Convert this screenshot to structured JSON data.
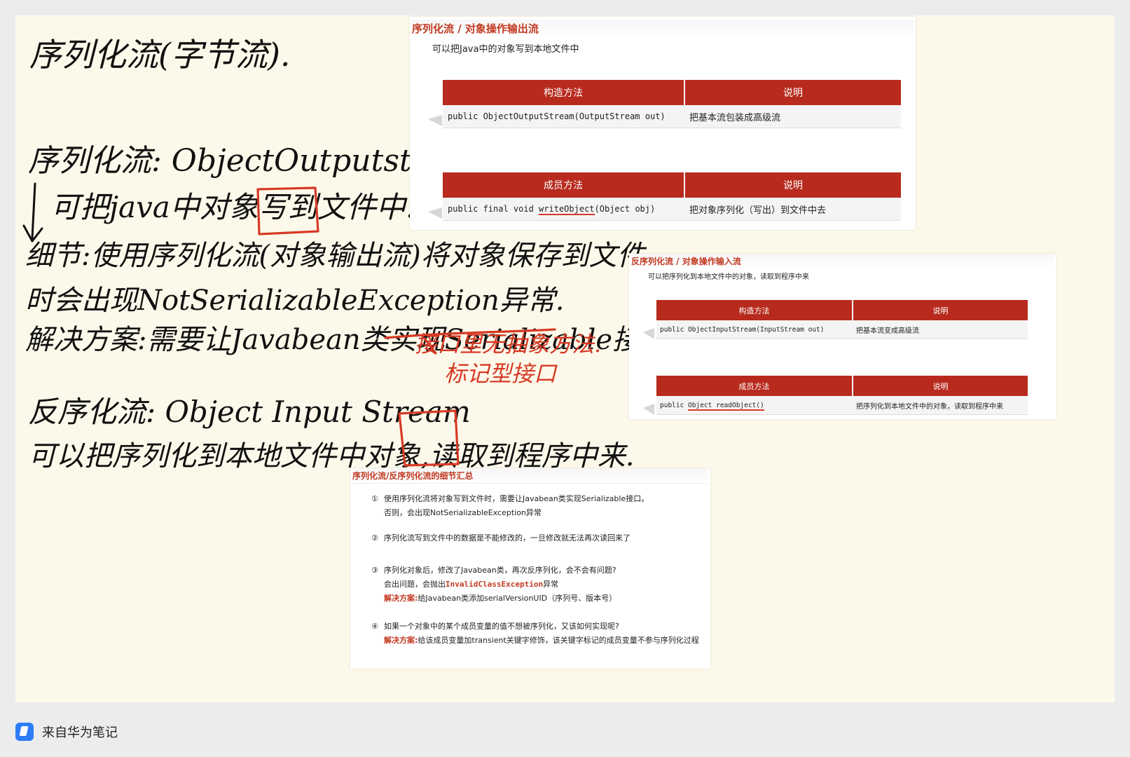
{
  "handwriting": {
    "title": "序列化流(字节流).",
    "line1": "序列化流: ObjectOutputstream.",
    "line2": "可把java中对象写到文件中.",
    "line3": "细节:使用序列化流(对象输出流)将对象保存到文件",
    "line4": "时会出现NotSerializableException异常.",
    "line5": "解决方案:需要让Javabean类实现Serializable接口.",
    "note_red_1": "接口里无抽象方法.",
    "note_red_2": "标记型接口",
    "line6": "反序化流: Object Input Stream",
    "line7": "可以把序列化到本地文件中对象,读取到程序中来."
  },
  "slide_output": {
    "title": "序列化流 / 对象操作输出流",
    "subtitle": "可以把Java中的对象写到本地文件中",
    "ctor_header": "构造方法",
    "desc_header": "说明",
    "ctor_code": "public ObjectOutputStream(OutputStream out)",
    "ctor_desc": "把基本流包装成高级流",
    "member_header": "成员方法",
    "member_desc_header": "说明",
    "member_code_prefix": "public final void ",
    "member_code_method": "writeObject",
    "member_code_suffix": "(Object obj)",
    "member_desc": "把对象序列化（写出）到文件中去"
  },
  "slide_input": {
    "title": "反序列化流 / 对象操作输入流",
    "subtitle": "可以把序列化到本地文件中的对象，读取到程序中来",
    "ctor_header": "构造方法",
    "desc_header": "说明",
    "ctor_code": "public ObjectInputStream(InputStream out)",
    "ctor_desc": "把基本流变成高级流",
    "member_header": "成员方法",
    "member_desc_header": "说明",
    "member_code_prefix": "public ",
    "member_code_type": "Object",
    "member_code_method": " readObject()",
    "member_desc": "把序列化到本地文件中的对象，读取到程序中来"
  },
  "slide_summary": {
    "title": "序列化流/反序列化流的细节汇总",
    "items": [
      {
        "num": "①",
        "line1": "使用序列化流将对象写到文件时，需要让Javabean类实现Serializable接口。",
        "line2": "否则，会出现NotSerializableException异常"
      },
      {
        "num": "②",
        "line1": "序列化流写到文件中的数据是不能修改的，一旦修改就无法再次读回来了"
      },
      {
        "num": "③",
        "line1": "序列化对象后，修改了Javabean类，再次反序列化，会不会有问题?",
        "line2_prefix": "会出问题，会抛出",
        "line2_red": "InvalidClassException",
        "line2_suffix": "异常",
        "line3_label": "解决方案:",
        "line3_text": "给Javabean类添加serialVersionUID（序列号、版本号）"
      },
      {
        "num": "④",
        "line1": "如果一个对象中的某个成员变量的值不想被序列化，又该如何实现呢?",
        "line2_label": "解决方案:",
        "line2_text": "给该成员变量加transient关键字修饰，该关键字标记的成员变量不参与序列化过程"
      }
    ]
  },
  "footer": {
    "text": "来自华为笔记",
    "icon": "huawei-notes-icon"
  },
  "colors": {
    "slide_title": "#c23a22",
    "table_header": "#b72a1d",
    "note_bg": "#fdf9ea",
    "ink_red": "#d63a25"
  }
}
